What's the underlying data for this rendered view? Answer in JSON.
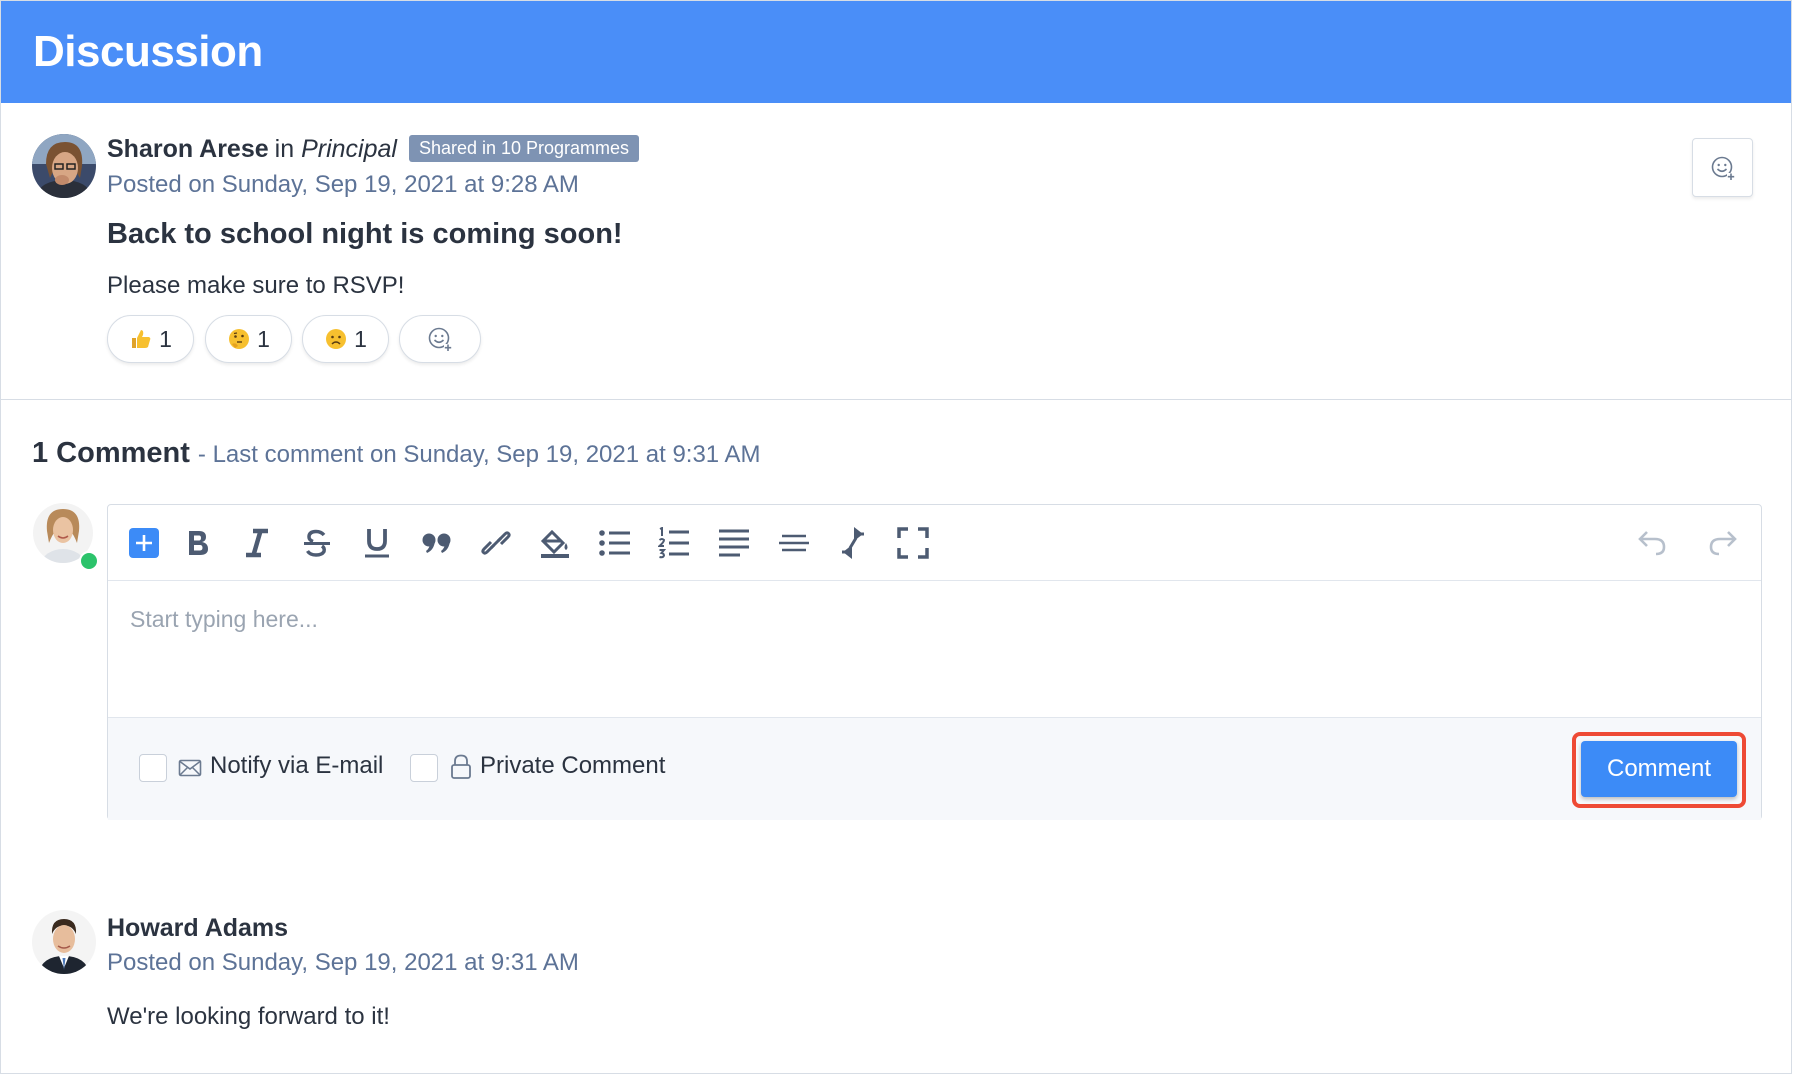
{
  "header": {
    "title": "Discussion"
  },
  "post": {
    "author": "Sharon Arese",
    "in_word": "in",
    "group": "Principal",
    "shared_badge": "Shared in 10 Programmes",
    "posted": "Posted on Sunday, Sep 19, 2021 at 9:28 AM",
    "title": "Back to school night is coming soon!",
    "body": "Please make sure to RSVP!",
    "reactions": [
      {
        "emoji": "thumbs-up-emoji",
        "count": "1"
      },
      {
        "emoji": "thinking-emoji",
        "count": "1"
      },
      {
        "emoji": "frowning-emoji",
        "count": "1"
      }
    ]
  },
  "comments_section": {
    "count_label": "1 Comment",
    "last_comment": "- Last comment on Sunday, Sep 19, 2021 at 9:31 AM"
  },
  "editor": {
    "placeholder": "Start typing here...",
    "toolbar": [
      "insert-plus-icon",
      "bold-icon",
      "italic-icon",
      "strikethrough-icon",
      "underline-icon",
      "quote-icon",
      "link-icon",
      "fill-color-icon",
      "bulleted-list-icon",
      "numbered-list-icon",
      "align-justify-icon",
      "horizontal-rule-icon",
      "merge-arrows-icon",
      "fullscreen-icon",
      "undo-icon",
      "redo-icon"
    ],
    "notify_label": "Notify via E-mail",
    "private_label": "Private Comment",
    "submit_label": "Comment"
  },
  "comment": {
    "author": "Howard Adams",
    "posted": "Posted on Sunday, Sep 19, 2021 at 9:31 AM",
    "body": "We're looking forward to it!"
  },
  "colors": {
    "header": "#4a8ef8",
    "accent": "#3c8bf7",
    "badge": "#7e93b3",
    "highlight": "#ee4a35",
    "online": "#2cc36b"
  }
}
